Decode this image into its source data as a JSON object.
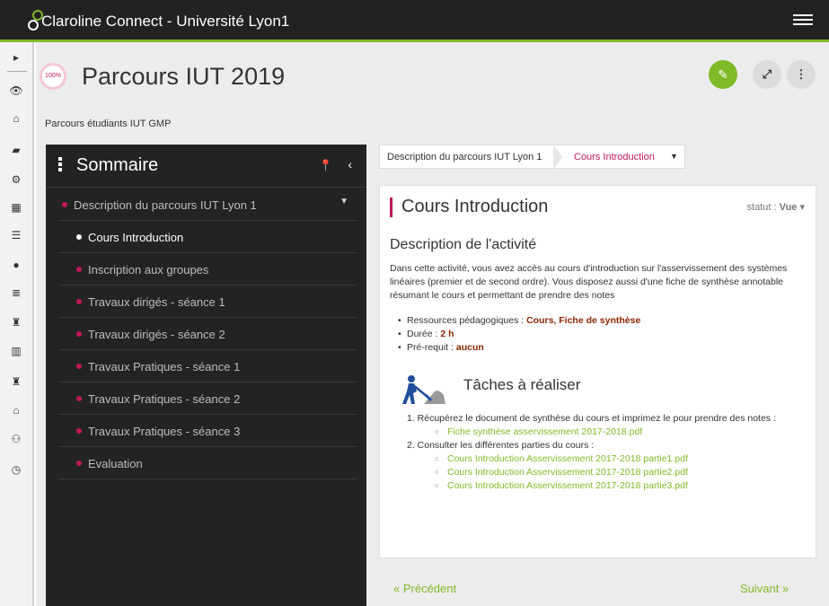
{
  "app": {
    "title": "Claroline Connect - Université Lyon1"
  },
  "rail": {
    "items": [
      "toggle-arrow-icon",
      "eye-icon",
      "home-icon",
      "folder-icon",
      "gear-icon",
      "calendar-icon",
      "list-icon",
      "user-icon",
      "table-icon",
      "trophy-icon",
      "bar-chart-icon",
      "trophy-icon",
      "graduation-cap-icon",
      "users-icon",
      "clock-icon"
    ]
  },
  "header": {
    "progress": "100%",
    "title": "Parcours IUT 2019",
    "subtitle": "Parcours étudiants IUT GMP"
  },
  "sommaire": {
    "title": "Sommaire",
    "items": [
      {
        "label": "Description du parcours IUT Lyon 1",
        "level": 0,
        "active": false,
        "has_caret": true
      },
      {
        "label": "Cours Introduction",
        "level": 1,
        "active": true
      },
      {
        "label": "Inscription aux groupes",
        "level": 1,
        "active": false
      },
      {
        "label": "Travaux dirigés - séance 1",
        "level": 1,
        "active": false
      },
      {
        "label": "Travaux dirigés - séance 2",
        "level": 1,
        "active": false
      },
      {
        "label": "Travaux Pratiques - séance 1",
        "level": 1,
        "active": false
      },
      {
        "label": "Travaux Pratiques - séance 2",
        "level": 1,
        "active": false
      },
      {
        "label": "Travaux Pratiques - séance 3",
        "level": 1,
        "active": false
      },
      {
        "label": "Evaluation",
        "level": 1,
        "active": false
      }
    ]
  },
  "breadcrumb": {
    "parent": "Description du parcours IUT Lyon 1",
    "current": "Cours Introduction"
  },
  "content": {
    "title": "Cours Introduction",
    "statut_label": "statut :",
    "statut_value": "Vue",
    "section_title": "Description de l'activité",
    "description": "Dans cette activité, vous avez accès au cours d'introduction sur l'asservissement des systèmes linéaires (premier et de second ordre). Vous disposez aussi d'une fiche de synthèse annotable résumant le cours et permettant de prendre des notes",
    "meta": [
      {
        "label": "Ressources pédagogiques :",
        "value": "Cours, Fiche de synthèse"
      },
      {
        "label": "Durée :",
        "value": "2 h"
      },
      {
        "label": "Pré-requit :",
        "value": "aucun"
      }
    ],
    "tasks_title": "Tâches à réaliser",
    "tasks": [
      {
        "text": "1. Récupérez le document de synthèse du cours et imprimez le pour prendre des notes :",
        "links": [
          "Fiche synthèse asservissement 2017-2018.pdf"
        ]
      },
      {
        "text": "2. Consulter les différentes parties du cours :",
        "links": [
          "Cours Introduction Asservissement 2017-2018 partie1.pdf",
          "Cours Introduction Asservissement 2017-2018 partie2.pdf",
          "Cours Introduction Asservissement 2017-2018 partie3.pdf"
        ]
      }
    ]
  },
  "nav": {
    "prev": "« Précédent",
    "next": "Suivant »"
  },
  "colors": {
    "accent_green": "#7fba27",
    "accent_pink": "#c2185b",
    "topbar": "#222222",
    "sidebar": "#232323"
  }
}
